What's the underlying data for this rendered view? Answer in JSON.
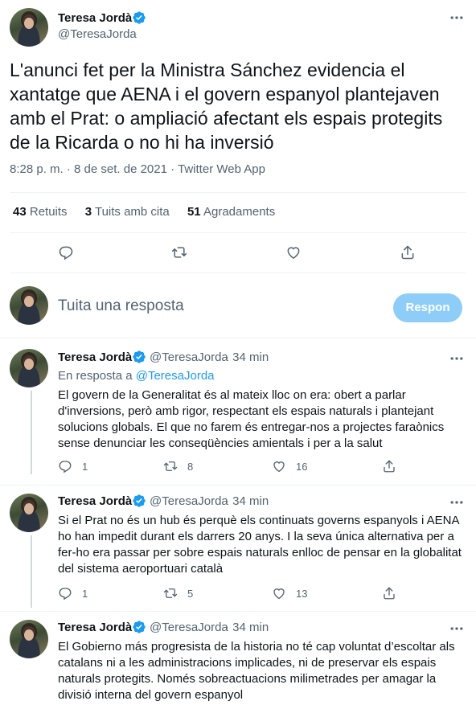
{
  "main_tweet": {
    "author_name": "Teresa Jordà",
    "author_handle": "@TeresaJorda",
    "text": "L'anunci fet per la Ministra Sánchez evidencia el xantatge que AENA i el govern espanyol plantejaven amb el Prat: o ampliació afectant els espais protegits de la Ricarda o no hi ha inversió",
    "timestamp": "8:28 p. m. · 8 de set. de 2021 · Twitter Web App",
    "stats": {
      "retweets_count": "43",
      "retweets_label": "Retuits",
      "quotes_count": "3",
      "quotes_label": "Tuits amb cita",
      "likes_count": "51",
      "likes_label": "Agradaments"
    }
  },
  "reply_box": {
    "placeholder": "Tuita una resposta",
    "button_label": "Respon"
  },
  "replies": [
    {
      "author_name": "Teresa Jordà",
      "author_handle": "@TeresaJorda",
      "time": "· 34 min",
      "reply_to_prefix": "En resposta a",
      "reply_to_handle": "@TeresaJorda",
      "text": "El govern de la Generalitat és al mateix lloc on era: obert a parlar d'inversions, però amb rigor, respectant els espais naturals i plantejant solucions globals. El que no farem és entregar-nos a projectes faraònics sense denunciar les conseqüències amientals i per a la salut",
      "replies": "1",
      "retweets": "8",
      "likes": "16"
    },
    {
      "author_name": "Teresa Jordà",
      "author_handle": "@TeresaJorda",
      "time": "· 34 min",
      "text": "Si el Prat no és un hub és perquè els continuats governs espanyols i AENA ho han impedit durant els darrers 20 anys. I la seva única alternativa per a fer-ho era passar per sobre espais naturals enlloc de pensar en la globalitat del sistema aeroportuari català",
      "replies": "1",
      "retweets": "5",
      "likes": "13"
    },
    {
      "author_name": "Teresa Jordà",
      "author_handle": "@TeresaJorda",
      "time": "· 34 min",
      "text": "El Gobierno más progresista de la historia no té cap voluntat d’escoltar als catalans ni a les administracions implicades, ni de preservar els espais naturals protegits. Només sobreactuacions milimetrades per amagar la divisió interna del govern espanyol"
    }
  ],
  "colors": {
    "accent": "#1d9bf0",
    "text": "#0f1419",
    "secondary_text": "#536471",
    "button_disabled": "#8ecdf8"
  },
  "icons": [
    "verified-badge-icon",
    "more-icon",
    "reply-icon",
    "retweet-icon",
    "like-icon",
    "share-icon"
  ]
}
